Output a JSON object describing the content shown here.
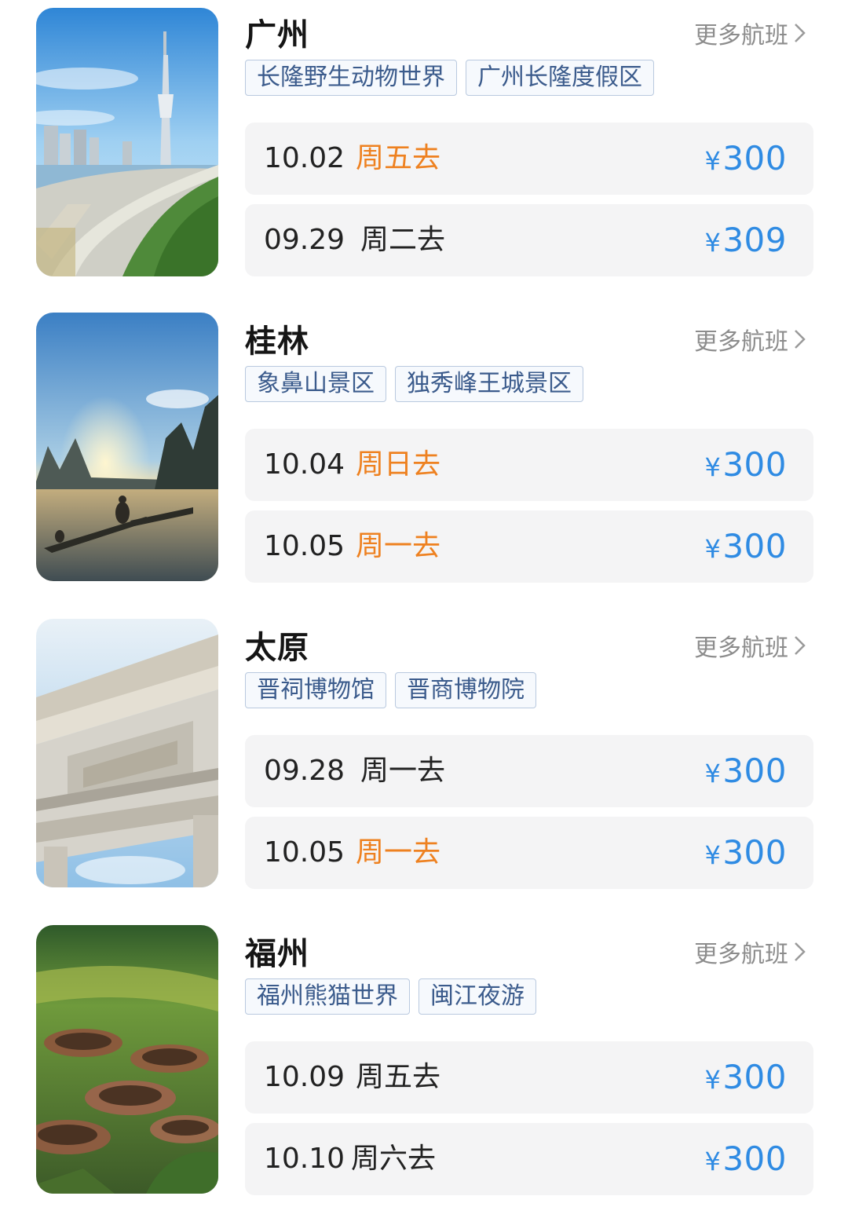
{
  "destinations": [
    {
      "city": "广州",
      "more_label": "更多航班",
      "image": "canton-tower-photo",
      "tags": [
        "长隆野生动物世界",
        "广州长隆度假区"
      ],
      "flights": [
        {
          "date": "10.02",
          "day": "周五去",
          "price": "300",
          "highlight": true
        },
        {
          "date": "09.29",
          "day": "周二去",
          "price": "309",
          "highlight": false
        }
      ]
    },
    {
      "city": "桂林",
      "more_label": "更多航班",
      "image": "li-river-photo",
      "tags": [
        "象鼻山景区",
        "独秀峰王城景区"
      ],
      "flights": [
        {
          "date": "10.04",
          "day": "周日去",
          "price": "300",
          "highlight": true
        },
        {
          "date": "10.05",
          "day": "周一去",
          "price": "300",
          "highlight": true
        }
      ]
    },
    {
      "city": "太原",
      "more_label": "更多航班",
      "image": "stone-archway-photo",
      "tags": [
        "晋祠博物馆",
        "晋商博物院"
      ],
      "flights": [
        {
          "date": "09.28",
          "day": "周一去",
          "price": "300",
          "highlight": false
        },
        {
          "date": "10.05",
          "day": "周一去",
          "price": "300",
          "highlight": true
        }
      ]
    },
    {
      "city": "福州",
      "more_label": "更多航班",
      "image": "tulou-village-photo",
      "tags": [
        "福州熊猫世界",
        "闽江夜游"
      ],
      "flights": [
        {
          "date": "10.09",
          "day": "周五去",
          "price": "300",
          "highlight": false
        },
        {
          "date": "10.10",
          "day": "周六去",
          "price": "300",
          "highlight": false
        }
      ]
    }
  ],
  "currency_symbol": "¥",
  "colors": {
    "price": "#2f8be3",
    "highlight_day": "#ee8120",
    "tag_text": "#3b5b8c",
    "tag_border": "#b9c9df",
    "row_bg": "#f4f4f5"
  }
}
